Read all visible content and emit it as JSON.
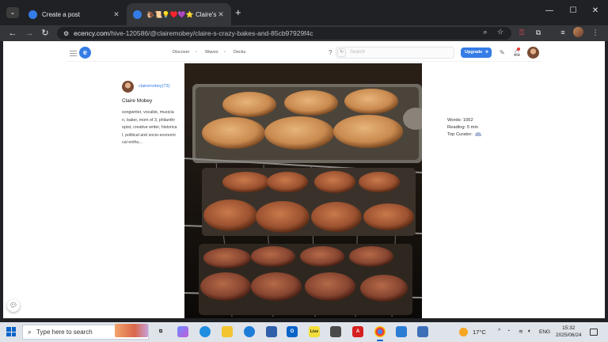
{
  "browser": {
    "tabs": [
      {
        "title": "Create a post",
        "close": "✕"
      },
      {
        "title": "🐌📜💡♥️💜⭐ Claire's Crazy",
        "close": "✕"
      }
    ],
    "new_tab": "+",
    "window_controls": {
      "minimize": "—",
      "maximize": "☐",
      "close": "✕"
    },
    "url_host": "ecency.com",
    "url_path": "/hive-120586/@clairemobey/claire-s-crazy-bakes-and-85cb97929f4c"
  },
  "site": {
    "nav": [
      "Discover",
      "Waves",
      "Decks"
    ],
    "search_placeholder": "Search",
    "upgrade_label": "Upgrade"
  },
  "author": {
    "handle": "clairemobey(73)",
    "name": "Claire Mobey",
    "bio": "songwriter, vocalist, musician, baker, mom of 3, philanthropist, creative writer, historical, political and socio-economical enthu..."
  },
  "stats": {
    "words": "Words: 1052",
    "reading": "Reading: 5 min",
    "curator": "Top Curator:"
  },
  "taskbar": {
    "search_text": "Type here to search",
    "temperature": "17°C",
    "language": "ENG",
    "time": "15:32",
    "date": "2025/06/24",
    "apps": [
      "Live"
    ]
  },
  "colors": {
    "accent": "#357ce6",
    "chrome_dark": "#202124",
    "chrome_toolbar": "#35363a"
  }
}
